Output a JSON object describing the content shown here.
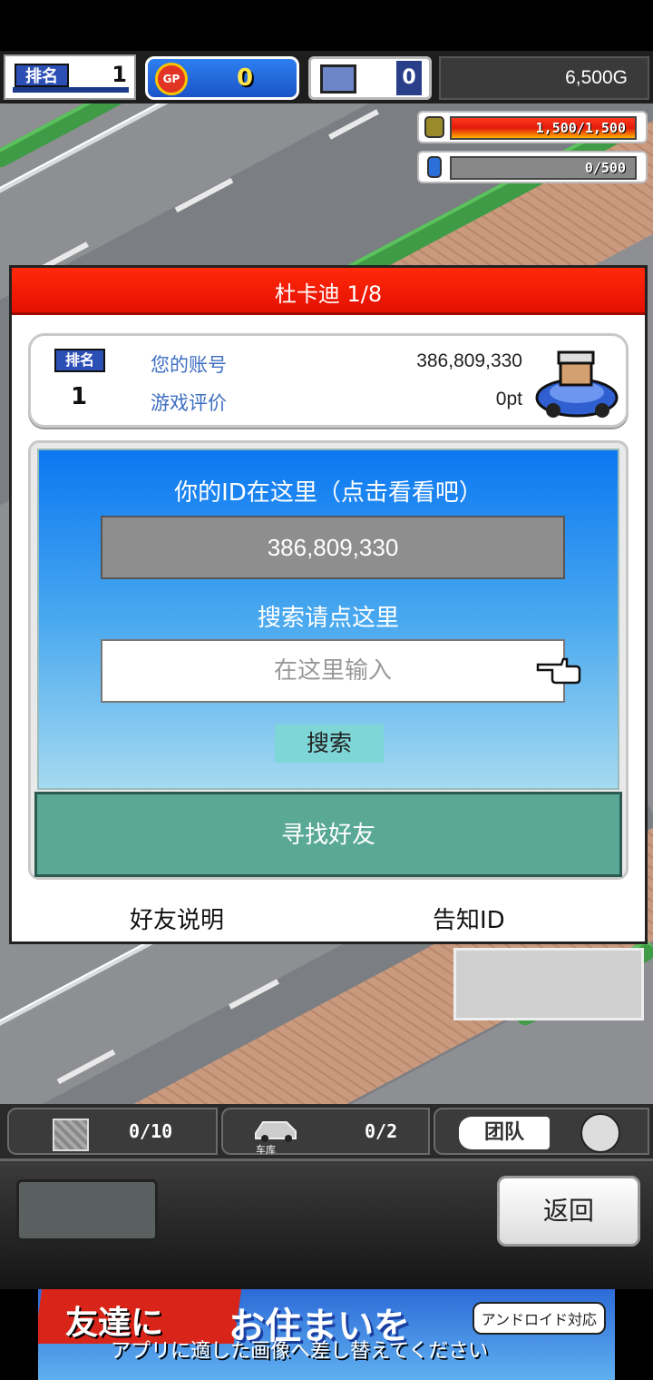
{
  "hud": {
    "rank_badge": "排名",
    "rank_value": "1",
    "gp_icon": "GP",
    "gp_value": "0",
    "pc_value": "0",
    "money": "6,500G",
    "fuel_bar": {
      "text": "1,500/1,500",
      "fill_fraction": 1.0
    },
    "water_bar": {
      "text": "0/500",
      "fill_fraction": 0.0
    }
  },
  "dialog": {
    "title": "杜卡迪 1/8",
    "account": {
      "rank_badge": "排名",
      "rank_value": "1",
      "account_label": "您的账号",
      "account_value": "386,809,330",
      "rating_label": "游戏评价",
      "rating_value": "0pt"
    },
    "id_heading": "你的ID在这里（点击看看吧）",
    "id_value": "386,809,330",
    "search_heading": "搜索请点这里",
    "search_placeholder": "在这里输入",
    "search_button": "搜索",
    "find_friends_button": "寻找好友",
    "friend_info_link": "好友说明",
    "notify_id_link": "告知ID"
  },
  "bottom_hud": {
    "storage_value": "0/10",
    "garage_label": "车库",
    "garage_value": "0/2",
    "team_label": "团队"
  },
  "controls": {
    "back_button": "返回"
  },
  "ad": {
    "logo_left": "友達に",
    "logo_right": "お住まいを",
    "corner": "アンドロイド対応",
    "subtitle": "アプリに適した画像へ差し替えてください"
  },
  "colors": {
    "title_red": "#e50f00",
    "panel_blue": "#0b78f2",
    "find_button_green": "#5aa996",
    "link_blue": "#3e6fc2"
  }
}
